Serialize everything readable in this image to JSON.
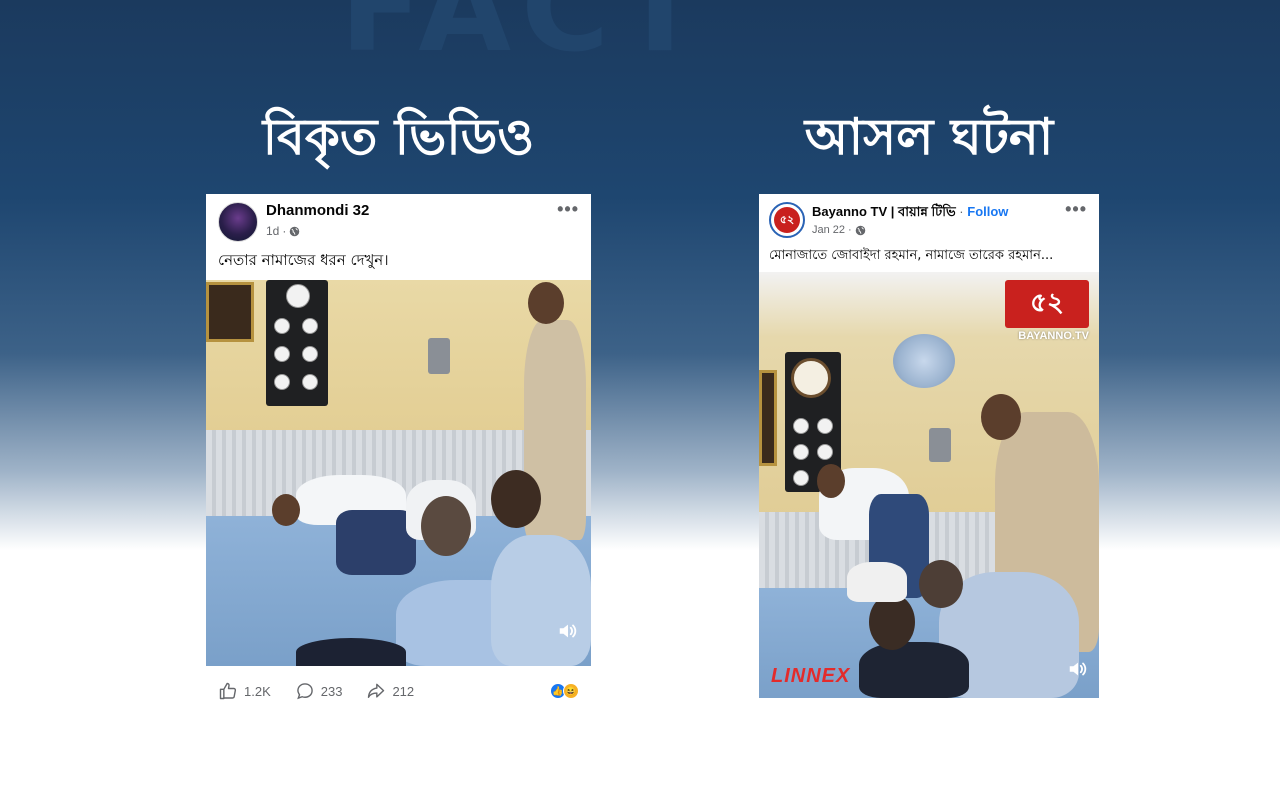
{
  "background_text": "FACT",
  "headings": {
    "left": "বিকৃত ভিডিও",
    "right": "আসল ঘটনা"
  },
  "left_post": {
    "page_name": "Dhanmondi 32",
    "time": "1d",
    "caption": "নেতার নামাজের ধরন দেখুন।",
    "stats": {
      "likes": "1.2K",
      "comments": "233",
      "shares": "212"
    },
    "icons": [
      "globe-icon",
      "more-icon",
      "speaker-icon",
      "like-icon",
      "comment-icon",
      "share-icon",
      "like-reaction-icon",
      "haha-reaction-icon"
    ]
  },
  "right_post": {
    "page_name": "Bayanno TV | বায়ান্ন টিভি",
    "follow_label": "Follow",
    "time": "Jan 22",
    "caption": "মোনাজাতে জোবাইদা রহমান, নামাজে তারেক রহমান...",
    "logo_text": "৫২",
    "logo_caption": "BAYANNO.TV",
    "watermark": "LINNEX"
  },
  "colors": {
    "accent": "#1877f2",
    "background_top": "#1b3a5e",
    "logo_red": "#c9211e",
    "watermark_red": "#e32b2b"
  }
}
